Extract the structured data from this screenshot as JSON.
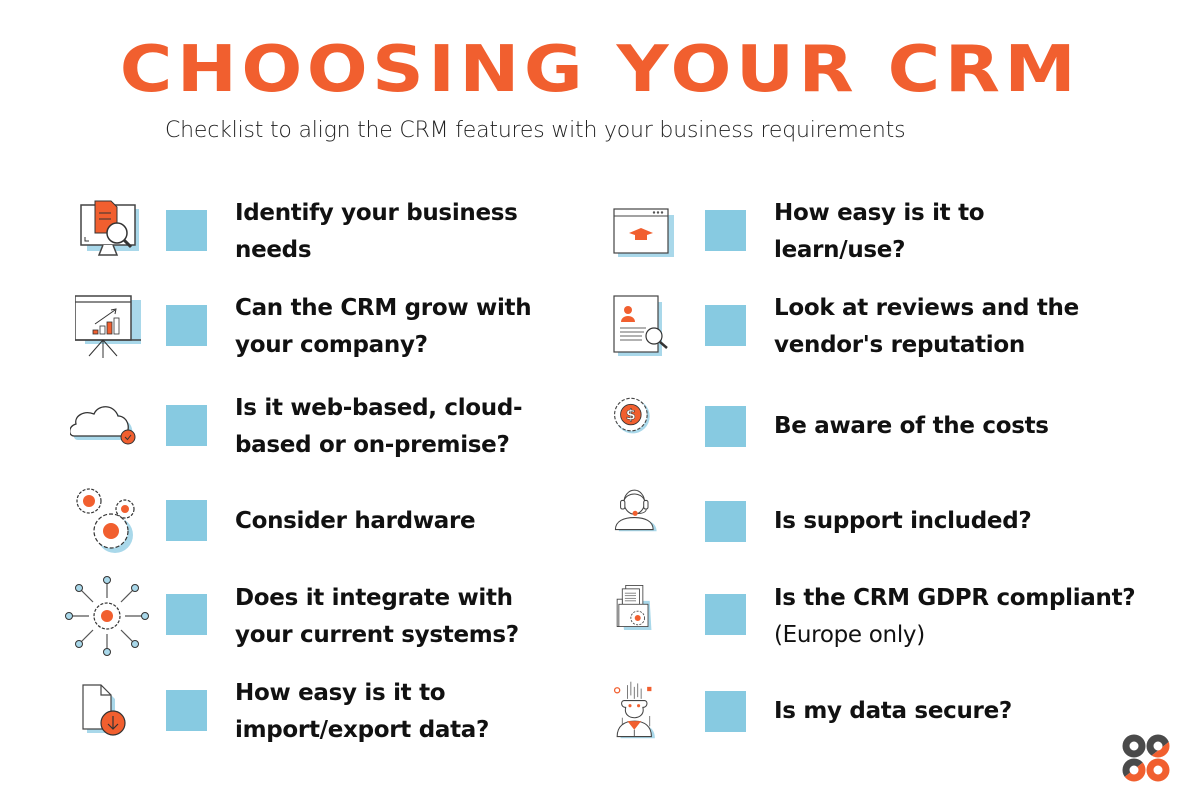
{
  "title": "CHOOSING YOUR CRM",
  "subtitle": "Checklist to align the CRM features with your business requirements",
  "colors": {
    "accent": "#f15f2f",
    "checkbox": "#87cae1",
    "shadow": "#a9d8ea",
    "text": "#111111",
    "logo_dark": "#4a4a4a"
  },
  "left_items": [
    {
      "icon": "monitor-document-search-icon",
      "line1": "Identify your business",
      "line2": "needs",
      "checked": false
    },
    {
      "icon": "presentation-growth-chart-icon",
      "line1": "Can the CRM grow with",
      "line2": "your company?",
      "checked": false
    },
    {
      "icon": "cloud-check-icon",
      "line1": "Is it web-based, cloud-",
      "line2": "based or on-premise?",
      "checked": false
    },
    {
      "icon": "gears-icon",
      "line1": "Consider hardware",
      "line2": "",
      "checked": false
    },
    {
      "icon": "integration-hub-icon",
      "line1": "Does it integrate with",
      "line2": "your current systems?",
      "checked": false
    },
    {
      "icon": "file-download-icon",
      "line1": "How easy is it to",
      "line2": "import/export data?",
      "checked": false
    }
  ],
  "right_items": [
    {
      "icon": "browser-graduation-cap-icon",
      "line1": "How easy is it to",
      "line2": "learn/use?",
      "checked": false
    },
    {
      "icon": "profile-review-search-icon",
      "line1": "Look at reviews and the",
      "line2": "vendor's reputation",
      "checked": false
    },
    {
      "icon": "dollar-gear-icon",
      "line1": "Be aware of the costs",
      "line2": "",
      "checked": false
    },
    {
      "icon": "support-headset-icon",
      "line1": "Is support included?",
      "line2": "",
      "checked": false
    },
    {
      "icon": "gdpr-folder-gear-icon",
      "line1": "Is the CRM GDPR compliant?",
      "line2": "",
      "note": "(Europe only)",
      "checked": false
    },
    {
      "icon": "data-security-person-icon",
      "line1": "Is my data secure?",
      "line2": "",
      "checked": false
    }
  ],
  "logo": {
    "icon": "brand-logo-icon"
  }
}
